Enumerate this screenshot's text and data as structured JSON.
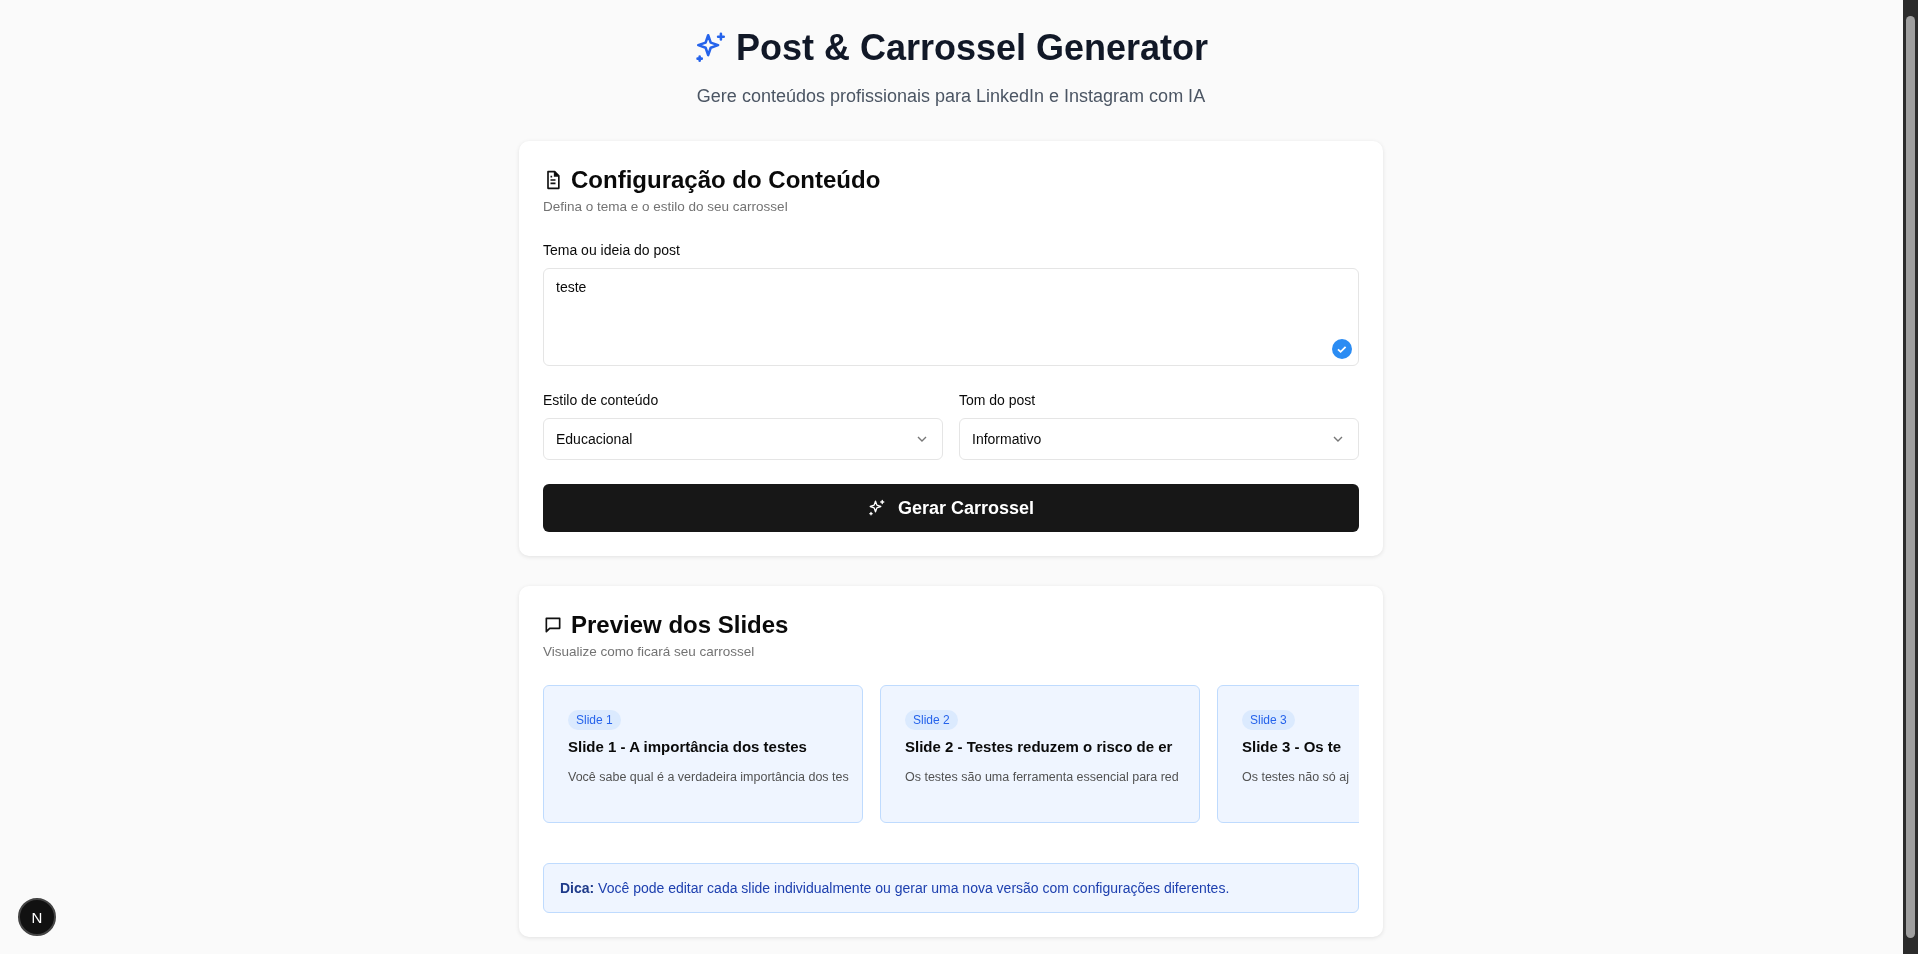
{
  "header": {
    "title": "Post & Carrossel Generator",
    "subtitle": "Gere conteúdos profissionais para LinkedIn e Instagram com IA"
  },
  "config": {
    "title": "Configuração do Conteúdo",
    "description": "Defina o tema e o estilo do seu carrossel",
    "topic": {
      "label": "Tema ou ideia do post",
      "value": "teste",
      "validated": true
    },
    "selects": [
      {
        "label": "Estilo de conteúdo",
        "value": "Educacional"
      },
      {
        "label": "Tom do post",
        "value": "Informativo"
      }
    ],
    "button": "Gerar Carrossel"
  },
  "preview": {
    "title": "Preview dos Slides",
    "description": "Visualize como ficará seu carrossel",
    "slides": [
      {
        "badge": "Slide 1",
        "title": "Slide 1 - A importância dos testes",
        "text": "Você sabe qual é a verdadeira importância dos tes"
      },
      {
        "badge": "Slide 2",
        "title": "Slide 2 - Testes reduzem o risco de er",
        "text": "Os testes são uma ferramenta essencial para red"
      },
      {
        "badge": "Slide 3",
        "title": "Slide 3 - Os te",
        "text": "Os testes não só aj"
      }
    ],
    "tip": "**Dica:** Você pode editar cada slide individualmente ou gerar uma nova versão com configurações diferentes."
  },
  "dev_badge": "N"
}
